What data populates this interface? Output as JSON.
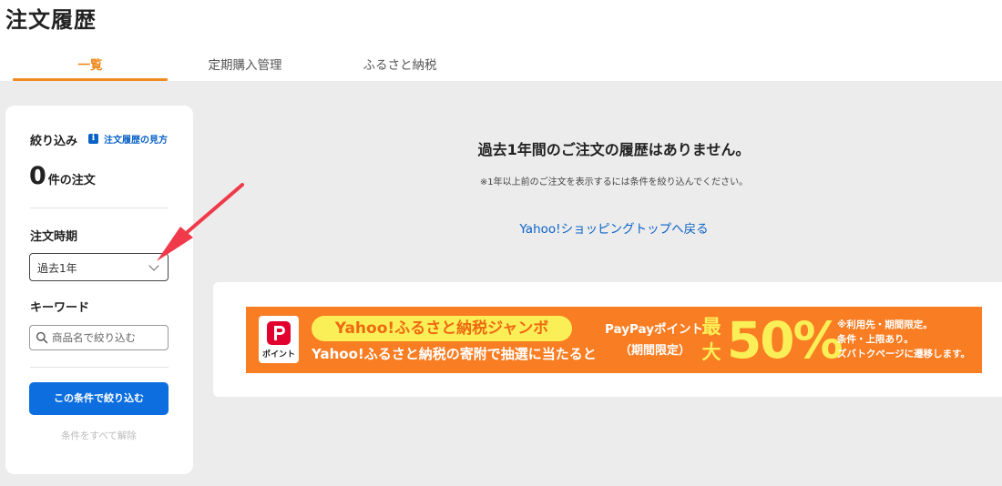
{
  "page": {
    "title": "注文履歴"
  },
  "tabs": [
    {
      "label": "一覧",
      "active": true
    },
    {
      "label": "定期購入管理",
      "active": false
    },
    {
      "label": "ふるさと納税",
      "active": false
    }
  ],
  "sidebar": {
    "filter_title": "絞り込み",
    "help_link": "注文履歴の見方",
    "order_count": "0",
    "order_count_suffix": "件の注文",
    "period_label": "注文時期",
    "period_value": "過去1年",
    "keyword_label": "キーワード",
    "keyword_placeholder": "商品名で絞り込む",
    "apply_button": "この条件で絞り込む",
    "clear_link": "条件をすべて解除"
  },
  "main": {
    "empty_message": "過去1年間のご注文の履歴はありません。",
    "sub_message": "※1年以上前のご注文を表示するには条件を絞り込んでください。",
    "back_link": "Yahoo!ショッピングトップへ戻る"
  },
  "banner": {
    "logo_text": "ポイント",
    "headline": "Yahoo!ふるさと納税ジャンボ",
    "subline": "Yahoo!ふるさと納税の寄附で抽選に当たると",
    "points_label": "PayPayポイント",
    "limited_label": "（期間限定）",
    "max_label": "最大",
    "percent": "50%",
    "notes": [
      "※利用先・期間限定。",
      "条件・上限あり。",
      "ズバトクページに遷移します。"
    ]
  },
  "colors": {
    "accent_orange": "#f08a1d",
    "link_blue": "#0c63c7",
    "button_blue": "#0d6ee0",
    "banner_orange": "#f97d22",
    "banner_yellow": "#fbef57",
    "annotation_red": "#f03a4a"
  }
}
